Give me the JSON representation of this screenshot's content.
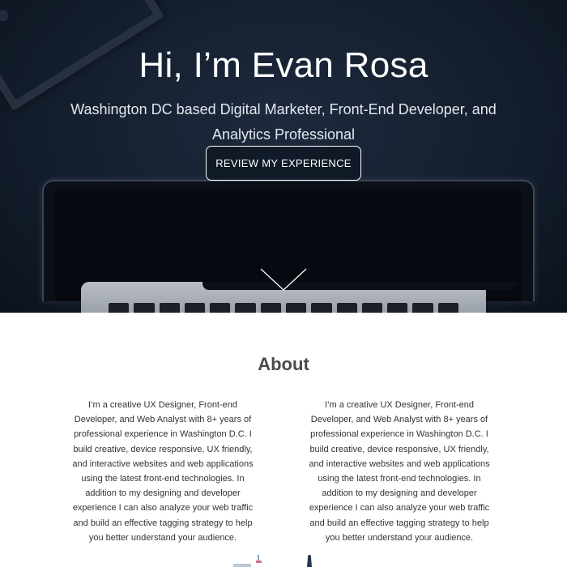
{
  "hero": {
    "title": "Hi, I’m Evan Rosa",
    "subtitle": "Washington DC based Digital Marketer, Front-End Developer, and Analytics Professional",
    "button_label": "REVIEW MY EXPERIENCE"
  },
  "about": {
    "title": "About",
    "columns": [
      "I’m a creative UX Designer, Front-end Developer, and Web Analyst with 8+ years of professional experience in Washington D.C. I build creative, device responsive, UX friendly, and interactive websites and web applications using the latest front-end technologies. In addition to my designing and developer experience I can also analyze your web traffic and build an effective tagging strategy to help you better understand your audience.",
      "I’m a creative UX Designer, Front-end Developer, and Web Analyst with 8+ years of professional experience in Washington D.C. I build creative, device responsive, UX friendly, and interactive websites and web applications using the latest front-end technologies. In addition to my designing and developer experience I can also analyze your web traffic and build an effective tagging strategy to help you better understand your audience."
    ]
  },
  "colors": {
    "hero_background": "#141e2d",
    "hero_text": "#ffffff",
    "section_title": "#4a4a4a",
    "body_text": "#333333"
  },
  "icons": [
    "scroll-down-chevron-icon",
    "laptop-image",
    "picture-frame-image",
    "workspace-illustration-icon"
  ]
}
